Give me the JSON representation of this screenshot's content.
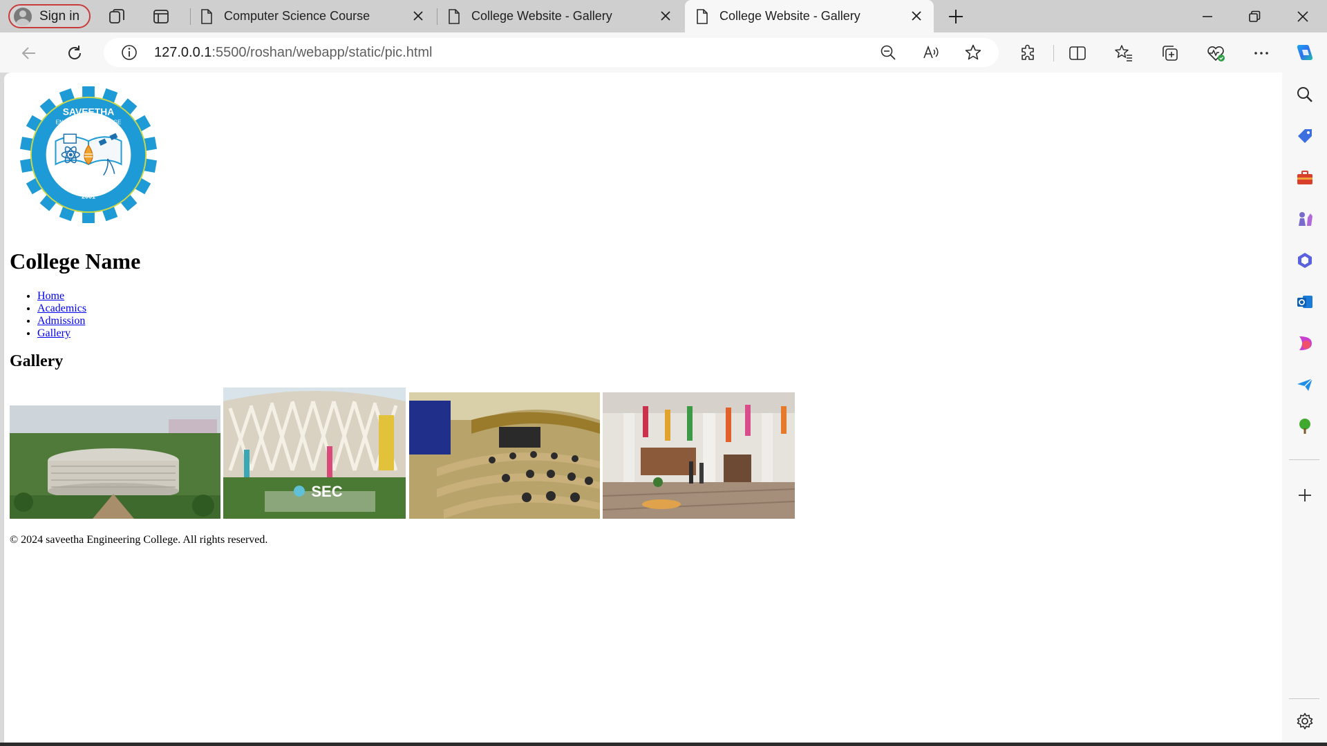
{
  "browser": {
    "profile_label": "Sign in",
    "tabs": [
      {
        "title": "Computer Science Course"
      },
      {
        "title": "College Website - Gallery"
      },
      {
        "title": "College Website - Gallery"
      }
    ],
    "url_host": "127.0.0.1",
    "url_path": ":5500/roshan/webapp/static/pic.html"
  },
  "page": {
    "logo": {
      "top_text": "SAVEETHA",
      "sub_text": "ENGINEERING COLLEGE",
      "motto": "BE THE BEST",
      "year": "2001"
    },
    "college_name": "College Name",
    "nav": {
      "home": "Home",
      "academics": "Academics",
      "admission": "Admission",
      "gallery": "Gallery"
    },
    "gallery_heading": "Gallery",
    "gallery_sign_text": "SEC",
    "footer": "© 2024 saveetha Engineering College. All rights reserved."
  }
}
